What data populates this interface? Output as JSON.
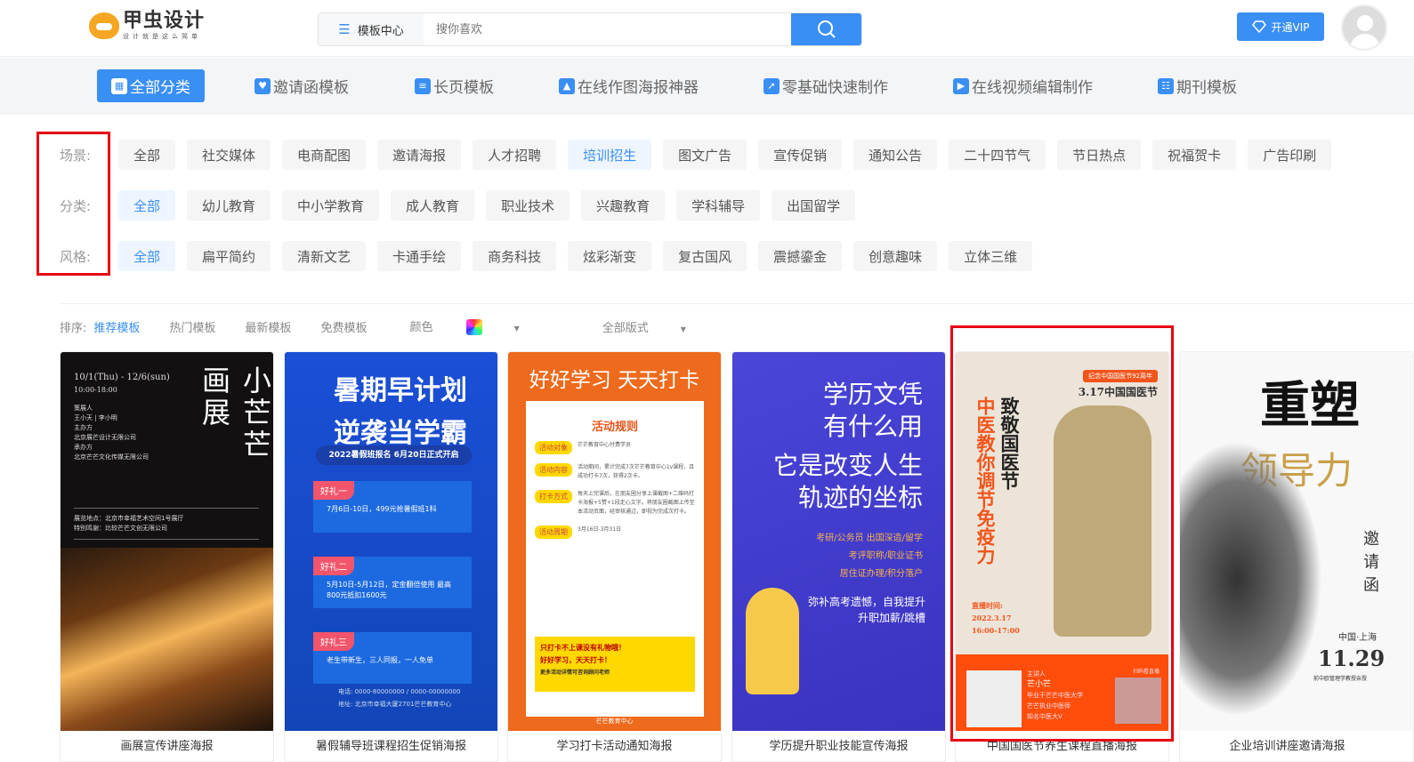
{
  "header": {
    "logo_name": "甲虫设计",
    "logo_slogan": "设计就是这么简单",
    "search_category": "模板中心",
    "search_placeholder": "搜你喜欢",
    "vip_label": "开通VIP"
  },
  "nav": [
    {
      "label": "全部分类",
      "icon": "grid-icon"
    },
    {
      "label": "邀请函模板",
      "icon": "map-pin-icon"
    },
    {
      "label": "长页模板",
      "icon": "clipboard-icon"
    },
    {
      "label": "在线作图海报神器",
      "icon": "image-icon"
    },
    {
      "label": "零基础快速制作",
      "icon": "rocket-icon"
    },
    {
      "label": "在线视频编辑制作",
      "icon": "video-icon"
    },
    {
      "label": "期刊模板",
      "icon": "list-icon"
    }
  ],
  "filters": {
    "scene": {
      "label": "场景:",
      "options": [
        "全部",
        "社交媒体",
        "电商配图",
        "邀请海报",
        "人才招聘",
        "培训招生",
        "图文广告",
        "宣传促销",
        "通知公告",
        "二十四节气",
        "节日热点",
        "祝福贺卡",
        "广告印刷"
      ],
      "selected": 5
    },
    "category": {
      "label": "分类:",
      "options": [
        "全部",
        "幼儿教育",
        "中小学教育",
        "成人教育",
        "职业技术",
        "兴趣教育",
        "学科辅导",
        "出国留学"
      ],
      "selected": 0
    },
    "style": {
      "label": "风格:",
      "options": [
        "全部",
        "扁平简约",
        "清新文艺",
        "卡通手绘",
        "商务科技",
        "炫彩渐变",
        "复古国风",
        "震撼鎏金",
        "创意趣味",
        "立体三维"
      ],
      "selected": 0
    }
  },
  "sort": {
    "label": "排序:",
    "options": [
      "推荐模板",
      "热门模板",
      "最新模板",
      "免费模板"
    ],
    "selected": 0,
    "color_label": "颜色",
    "layout_label": "全部版式"
  },
  "cards": [
    {
      "title": "画展宣传讲座海报",
      "poster": {
        "headline": "小芒芒画展",
        "date": "10/1(Thu) - 12/6(sun)",
        "time": "10:00-18:00",
        "lines": [
          "策展人",
          "王小天 | 李小明",
          "主办方",
          "北京展芒设计无限公司",
          "承办方",
          "北京芒芒文化传媒无限公司"
        ],
        "address": "展览地点：北京市幸福艺术空间1号展厅",
        "sponsor": "特别鸣谢：比较芒芒文创无限公司"
      }
    },
    {
      "title": "暑假辅导班课程招生促销海报",
      "poster": {
        "headline1": "暑期早计划",
        "headline2": "逆袭当学霸",
        "banner": "2022暑假班报名 6月20日正式开启",
        "gifts": [
          {
            "tag": "好礼一",
            "text": "7月6日-10日，499元抢暑假班1科"
          },
          {
            "tag": "好礼二",
            "text": "5月10日-5月12日，定金翻倍使用 最高800元抵扣1600元"
          },
          {
            "tag": "好礼三",
            "text": "老生带新生，三人同报，一人免单"
          }
        ],
        "phone": "电话: 0000-80000000 / 0000-00000000",
        "address": "地址: 北京市幸福大厦2701芒芒教育中心"
      }
    },
    {
      "title": "学习打卡活动通知海报",
      "poster": {
        "headline": "好好学习 天天打卡",
        "rules_title": "活动规则",
        "rules": [
          {
            "tag": "活动对象",
            "text": "芒芒教育中心付费学员"
          },
          {
            "tag": "活动内容",
            "text": "活动期间，累计完成7次芒芒教育中心1v课程，且成功打卡7次，获得2次卡。"
          },
          {
            "tag": "打卡方式",
            "text": "每天上完课后，在朋友圈分享上课截图+二维码打卡海报+5赞+1段走心文字。将朋友圈截图上传至本活动页面，经审核通过，即视为完成次打卡。"
          },
          {
            "tag": "活动周期",
            "text": "3月16日-3月31日"
          }
        ],
        "note1": "只打卡不上课没有礼物哦！",
        "note2": "好好学习，天天打卡！",
        "note3": "更多活动详情可咨询顾问老师",
        "footer": "芒芒教育中心"
      }
    },
    {
      "title": "学历提升职业技能宣传海报",
      "poster": {
        "headline1": "学历文凭",
        "headline2": "有什么用",
        "headline3": "它是改变人生",
        "headline4": "轨迹的坐标",
        "items": [
          "考研/公务员 出国深造/留学",
          "考评职称/职业证书",
          "居住证办理/积分落户"
        ],
        "tail1": "弥补高考遗憾，自我提升",
        "tail2": "升职加薪/跳槽"
      }
    },
    {
      "title": "中国国医节养生课程直播海报",
      "poster": {
        "badge": "纪念中国国医节92周年",
        "date_title": "3.17中国国医节",
        "col1": "致敬国医节",
        "col2": "中医教你调节免疫力",
        "live_label": "直播时间:",
        "live_date": "2022.3.17",
        "live_time": "16:00-17:00",
        "speaker_tag": "主讲人",
        "speaker": "芒小芒",
        "bio": [
          "毕业于芒芒中医大学",
          "芒芒执业中医师",
          "知名中医大V"
        ],
        "scan": "扫码看直播"
      }
    },
    {
      "title": "企业培训讲座邀请海报",
      "poster": {
        "headline1": "重塑",
        "headline2": "领导力",
        "side": "邀请函",
        "place": "中国·上海",
        "date": "11.29",
        "sub": "前中欧管理学教授亲授"
      }
    }
  ],
  "colors": {
    "accent": "#3a8ff5",
    "annotation": "#e60012"
  }
}
